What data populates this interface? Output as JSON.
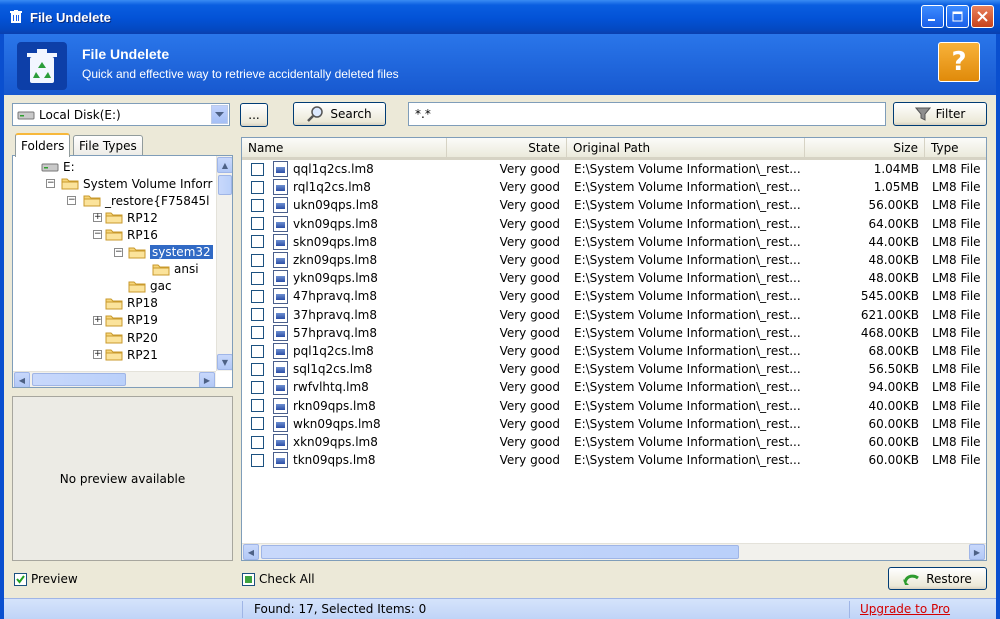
{
  "window": {
    "title": "File Undelete"
  },
  "header": {
    "title": "File Undelete",
    "subtitle": "Quick and effective way to retrieve accidentally deleted files",
    "help_glyph": "?"
  },
  "toolbar": {
    "drive": "Local Disk(E:)",
    "browse_label": "...",
    "search_label": "Search",
    "mask_value": "*.*",
    "filter_label": "Filter"
  },
  "tabs": {
    "folders": "Folders",
    "file_types": "File Types"
  },
  "tree": [
    {
      "label": "E:",
      "expander": "",
      "icon": "disk"
    },
    {
      "label": "System Volume Inforr",
      "expander": "−",
      "icon": "folder"
    },
    {
      "label": "_restore{F75845l",
      "expander": "−",
      "icon": "folder"
    },
    {
      "label": "RP12",
      "expander": "+",
      "icon": "folder"
    },
    {
      "label": "RP16",
      "expander": "−",
      "icon": "folder"
    },
    {
      "label": "system32",
      "expander": "−",
      "icon": "folder",
      "selected": true
    },
    {
      "label": "ansi",
      "expander": "",
      "icon": "folder"
    },
    {
      "label": "gac",
      "expander": "",
      "icon": "folder"
    },
    {
      "label": "RP18",
      "expander": "",
      "icon": "folder"
    },
    {
      "label": "RP19",
      "expander": "+",
      "icon": "folder"
    },
    {
      "label": "RP20",
      "expander": "",
      "icon": "folder"
    },
    {
      "label": "RP21",
      "expander": "+",
      "icon": "folder"
    }
  ],
  "preview": {
    "text": "No preview available",
    "checkbox_label": "Preview",
    "checked": true
  },
  "columns": {
    "name": "Name",
    "state": "State",
    "path": "Original Path",
    "size": "Size",
    "type": "Type"
  },
  "files": [
    {
      "name": "qql1q2cs.lm8",
      "state": "Very good",
      "path": "E:\\System Volume Information\\_rest...",
      "size": "1.04MB",
      "type": "LM8 File"
    },
    {
      "name": "rql1q2cs.lm8",
      "state": "Very good",
      "path": "E:\\System Volume Information\\_rest...",
      "size": "1.05MB",
      "type": "LM8 File"
    },
    {
      "name": "ukn09qps.lm8",
      "state": "Very good",
      "path": "E:\\System Volume Information\\_rest...",
      "size": "56.00KB",
      "type": "LM8 File"
    },
    {
      "name": "vkn09qps.lm8",
      "state": "Very good",
      "path": "E:\\System Volume Information\\_rest...",
      "size": "64.00KB",
      "type": "LM8 File"
    },
    {
      "name": "skn09qps.lm8",
      "state": "Very good",
      "path": "E:\\System Volume Information\\_rest...",
      "size": "44.00KB",
      "type": "LM8 File"
    },
    {
      "name": "zkn09qps.lm8",
      "state": "Very good",
      "path": "E:\\System Volume Information\\_rest...",
      "size": "48.00KB",
      "type": "LM8 File"
    },
    {
      "name": "ykn09qps.lm8",
      "state": "Very good",
      "path": "E:\\System Volume Information\\_rest...",
      "size": "48.00KB",
      "type": "LM8 File"
    },
    {
      "name": "47hpravq.lm8",
      "state": "Very good",
      "path": "E:\\System Volume Information\\_rest...",
      "size": "545.00KB",
      "type": "LM8 File"
    },
    {
      "name": "37hpravq.lm8",
      "state": "Very good",
      "path": "E:\\System Volume Information\\_rest...",
      "size": "621.00KB",
      "type": "LM8 File"
    },
    {
      "name": "57hpravq.lm8",
      "state": "Very good",
      "path": "E:\\System Volume Information\\_rest...",
      "size": "468.00KB",
      "type": "LM8 File"
    },
    {
      "name": "pql1q2cs.lm8",
      "state": "Very good",
      "path": "E:\\System Volume Information\\_rest...",
      "size": "68.00KB",
      "type": "LM8 File"
    },
    {
      "name": "sql1q2cs.lm8",
      "state": "Very good",
      "path": "E:\\System Volume Information\\_rest...",
      "size": "56.50KB",
      "type": "LM8 File"
    },
    {
      "name": "rwfvlhtq.lm8",
      "state": "Very good",
      "path": "E:\\System Volume Information\\_rest...",
      "size": "94.00KB",
      "type": "LM8 File"
    },
    {
      "name": "rkn09qps.lm8",
      "state": "Very good",
      "path": "E:\\System Volume Information\\_rest...",
      "size": "40.00KB",
      "type": "LM8 File"
    },
    {
      "name": "wkn09qps.lm8",
      "state": "Very good",
      "path": "E:\\System Volume Information\\_rest...",
      "size": "60.00KB",
      "type": "LM8 File"
    },
    {
      "name": "xkn09qps.lm8",
      "state": "Very good",
      "path": "E:\\System Volume Information\\_rest...",
      "size": "60.00KB",
      "type": "LM8 File"
    },
    {
      "name": "tkn09qps.lm8",
      "state": "Very good",
      "path": "E:\\System Volume Information\\_rest...",
      "size": "60.00KB",
      "type": "LM8 File"
    }
  ],
  "bottom": {
    "check_all_label": "Check All",
    "restore_label": "Restore"
  },
  "status": {
    "found_text": "Found: 17, Selected Items: 0",
    "upgrade_link": "Upgrade to Pro"
  },
  "colors": {
    "titlebar": "#0352d6",
    "banner": "#1f66dd",
    "accent": "#f7b83b",
    "link": "#d40000"
  }
}
